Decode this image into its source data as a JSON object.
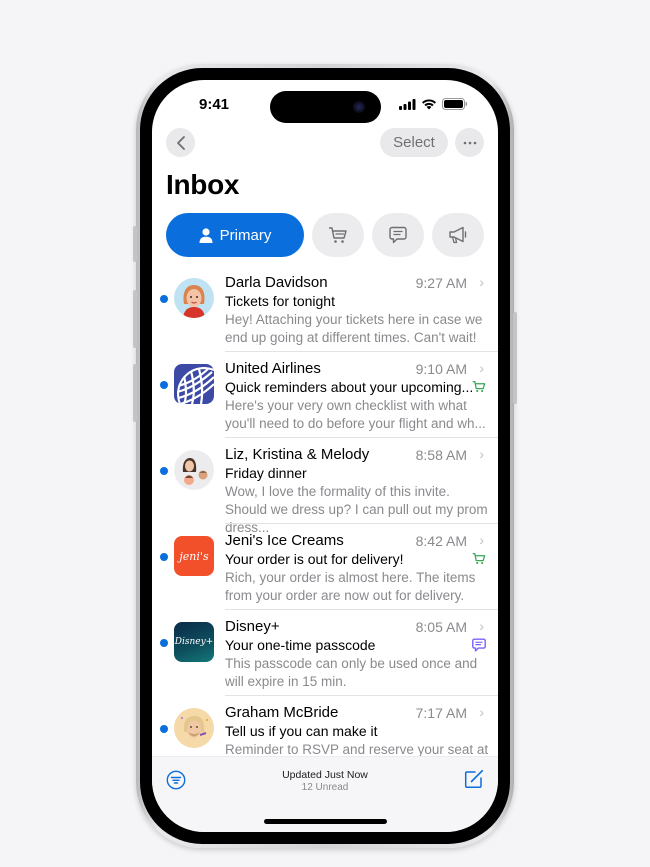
{
  "status_bar": {
    "time": "9:41",
    "icons": [
      "cellular-signal-icon",
      "wifi-icon",
      "battery-icon"
    ]
  },
  "nav": {
    "back_icon": "chevron-left-icon",
    "select_label": "Select",
    "more_icon": "ellipsis-icon"
  },
  "title": "Inbox",
  "tabs": [
    {
      "label": "Primary",
      "icon": "person-icon",
      "selected": true
    },
    {
      "label": "",
      "icon": "cart-icon",
      "selected": false
    },
    {
      "label": "",
      "icon": "message-icon",
      "selected": false
    },
    {
      "label": "",
      "icon": "megaphone-icon",
      "selected": false
    }
  ],
  "colors": {
    "accent": "#0a6edc",
    "shopping": "#34a853",
    "updates": "#7b61ff",
    "secondary_text": "#8a8a8e"
  },
  "mails": [
    {
      "sender": "Darla Davidson",
      "time": "9:27 AM",
      "subject": "Tickets for tonight",
      "preview": "Hey! Attaching your tickets here in case we end up going at different times. Can't wait!",
      "unread": true,
      "category_icon": ""
    },
    {
      "sender": "United Airlines",
      "time": "9:10 AM",
      "subject": "Quick reminders about your upcoming...",
      "preview": "Here's your very own checklist with what you'll need to do before your flight and wh...",
      "unread": true,
      "category_icon": "cart-icon"
    },
    {
      "sender": "Liz, Kristina & Melody",
      "time": "8:58 AM",
      "subject": "Friday dinner",
      "preview": "Wow, I love the formality of this invite. Should we dress up? I can pull out my prom dress...",
      "unread": true,
      "category_icon": ""
    },
    {
      "sender": "Jeni's Ice Creams",
      "time": "8:42 AM",
      "subject": "Your order is out for delivery!",
      "preview": "Rich, your order is almost here. The items from your order are now out for delivery.",
      "unread": true,
      "category_icon": "cart-icon",
      "logo_text": "jeni's"
    },
    {
      "sender": "Disney+",
      "time": "8:05 AM",
      "subject": "Your one-time passcode",
      "preview": "This passcode can only be used once and will expire in 15 min.",
      "unread": true,
      "category_icon": "message-icon",
      "logo_text": "Disney+"
    },
    {
      "sender": "Graham McBride",
      "time": "7:17 AM",
      "subject": "Tell us if you can make it",
      "preview": "Reminder to RSVP and reserve your seat at",
      "unread": true,
      "category_icon": ""
    }
  ],
  "bottom_bar": {
    "status": "Updated Just Now",
    "unread_count": "12 Unread",
    "filter_icon": "filter-icon",
    "compose_icon": "compose-icon"
  }
}
